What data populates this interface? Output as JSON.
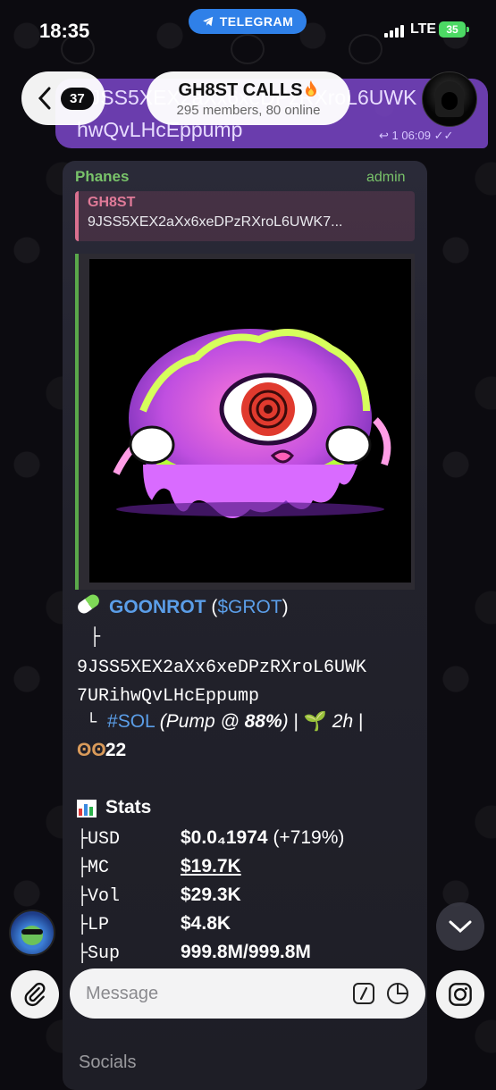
{
  "status_bar": {
    "time": "18:35",
    "app_pill": "TELEGRAM",
    "network": "LTE",
    "battery": "35"
  },
  "header": {
    "back_count": "37",
    "title": "GH8ST CALLS",
    "subtitle": "295 members, 80 online"
  },
  "previous_message": {
    "line1": "9JSS5XEX2aXx6xeDPzRXroL6UWK",
    "line2": "hwQvLHcEppump",
    "replies": "1",
    "time": "06:09"
  },
  "message": {
    "sender": "Phanes",
    "role": "admin",
    "reply": {
      "name": "GH8ST",
      "text": "9JSS5XEX2aXx6xeDPzRXroL6UWK7..."
    },
    "token_name": "GOONROT",
    "ticker": "$GROT",
    "address_line1": "9JSS5XEX2aXx6xeDPzRXroL6UWK",
    "address_line2": "7URihwQvLHcEppump",
    "chain": "#SOL",
    "pump": "(Pump @ ",
    "pump_pct": "88%",
    "pump_close": ")",
    "age": "2h",
    "views": "22",
    "stats_title": "Stats",
    "stats": [
      {
        "key": "├USD",
        "value": "$0.0₄1974",
        "extra": " (+719%)"
      },
      {
        "key": "├MC",
        "value": "$19.7K",
        "extra": ""
      },
      {
        "key": "├Vol",
        "value": "$29.3K",
        "extra": ""
      },
      {
        "key": "├LP",
        "value": "$4.8K",
        "extra": ""
      },
      {
        "key": "├Sup",
        "value": "999.8M/999.8M",
        "extra": ""
      }
    ],
    "socials_peek": "Socials"
  },
  "input": {
    "placeholder": "Message"
  },
  "colors": {
    "telegram_blue": "#2f80e8",
    "admin_green": "#79c36a",
    "link_blue": "#5b9ee8",
    "reply_pink": "#e07a98",
    "purple_bubble": "#7b46c9"
  }
}
